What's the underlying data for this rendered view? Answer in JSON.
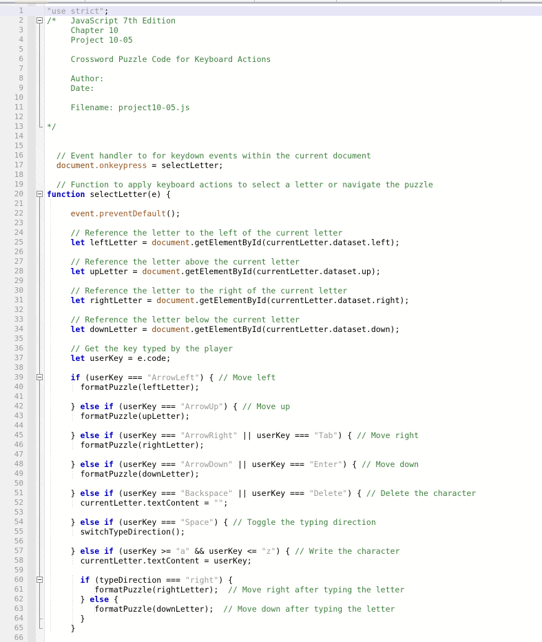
{
  "window": {
    "title": "project10-05.js",
    "language": "JavaScript"
  },
  "toolbar": {
    "visible": true,
    "separator_positions": [
      123,
      369,
      488,
      727
    ],
    "chip": {
      "x": 22,
      "width": 48
    }
  },
  "editor": {
    "first_visible_line": 1,
    "total_visible_lines": 66,
    "current_line": 1,
    "line_height": 14,
    "gutter_width": 64,
    "colors": {
      "background": "#fffffd",
      "line_number_bg": "#f0f0f0",
      "line_number_fg": "#9a9a9a",
      "current_line_bg": "#e6e6f7",
      "keyword": "#0000c0",
      "comment": "#3f7f3f",
      "string": "#9a9a9a",
      "object": "#8a4a12",
      "property": "#9a5a2a",
      "plain": "#000000"
    }
  },
  "fold_markers": [
    {
      "line": 2,
      "type": "open",
      "endline": 13
    },
    {
      "line": 20,
      "type": "open",
      "endline": 65
    },
    {
      "line": 39,
      "type": "open",
      "endline": 65
    },
    {
      "line": 60,
      "type": "open",
      "endline": 64
    }
  ],
  "lines": [
    {
      "n": 1,
      "indent": 0,
      "tokens": [
        {
          "t": "st",
          "v": "\"use strict\""
        },
        {
          "t": "pl",
          "v": ";"
        }
      ]
    },
    {
      "n": 2,
      "indent": 0,
      "tokens": [
        {
          "t": "cm",
          "v": "/*   JavaScript 7th Edition"
        }
      ]
    },
    {
      "n": 3,
      "indent": 0,
      "tokens": [
        {
          "t": "cm",
          "v": "     Chapter 10"
        }
      ]
    },
    {
      "n": 4,
      "indent": 0,
      "tokens": [
        {
          "t": "cm",
          "v": "     Project 10-05"
        }
      ]
    },
    {
      "n": 5,
      "indent": 0,
      "tokens": []
    },
    {
      "n": 6,
      "indent": 0,
      "tokens": [
        {
          "t": "cm",
          "v": "     Crossword Puzzle Code for Keyboard Actions"
        }
      ]
    },
    {
      "n": 7,
      "indent": 0,
      "tokens": []
    },
    {
      "n": 8,
      "indent": 0,
      "tokens": [
        {
          "t": "cm",
          "v": "     Author:"
        }
      ]
    },
    {
      "n": 9,
      "indent": 0,
      "tokens": [
        {
          "t": "cm",
          "v": "     Date:"
        }
      ]
    },
    {
      "n": 10,
      "indent": 0,
      "tokens": []
    },
    {
      "n": 11,
      "indent": 0,
      "tokens": [
        {
          "t": "cm",
          "v": "     Filename: project10-05.js"
        }
      ]
    },
    {
      "n": 12,
      "indent": 0,
      "tokens": []
    },
    {
      "n": 13,
      "indent": 0,
      "tokens": [
        {
          "t": "cm",
          "v": "*/"
        }
      ]
    },
    {
      "n": 14,
      "indent": 0,
      "tokens": []
    },
    {
      "n": 15,
      "indent": 0,
      "tokens": []
    },
    {
      "n": 16,
      "indent": 0,
      "tokens": [
        {
          "t": "cm",
          "v": "  // Event handler to for keydown events within the current document"
        }
      ]
    },
    {
      "n": 17,
      "indent": 0,
      "tokens": [
        {
          "t": "ob",
          "v": "  document"
        },
        {
          "t": "pr",
          "v": ".onkeypress"
        },
        {
          "t": "pl",
          "v": " = selectLetter;"
        }
      ]
    },
    {
      "n": 18,
      "indent": 0,
      "tokens": []
    },
    {
      "n": 19,
      "indent": 0,
      "tokens": [
        {
          "t": "cm",
          "v": "  // Function to apply keyboard actions to select a letter or navigate the puzzle"
        }
      ]
    },
    {
      "n": 20,
      "indent": 0,
      "tokens": [
        {
          "t": "k",
          "v": "function"
        },
        {
          "t": "pl",
          "v": " selectLetter(e) {"
        }
      ]
    },
    {
      "n": 21,
      "indent": 0,
      "tokens": []
    },
    {
      "n": 22,
      "indent": 0,
      "tokens": [
        {
          "t": "ob",
          "v": "     event"
        },
        {
          "t": "pr",
          "v": ".preventDefault"
        },
        {
          "t": "pl",
          "v": "();"
        }
      ]
    },
    {
      "n": 23,
      "indent": 0,
      "tokens": []
    },
    {
      "n": 24,
      "indent": 0,
      "tokens": [
        {
          "t": "cm",
          "v": "     // Reference the letter to the left of the current letter"
        }
      ]
    },
    {
      "n": 25,
      "indent": 0,
      "tokens": [
        {
          "t": "pl",
          "v": "     "
        },
        {
          "t": "k",
          "v": "let"
        },
        {
          "t": "pl",
          "v": " leftLetter = "
        },
        {
          "t": "ob",
          "v": "document"
        },
        {
          "t": "pl",
          "v": ".getElementById(currentLetter.dataset.left);"
        }
      ]
    },
    {
      "n": 26,
      "indent": 0,
      "tokens": []
    },
    {
      "n": 27,
      "indent": 0,
      "tokens": [
        {
          "t": "cm",
          "v": "     // Reference the letter above the current letter"
        }
      ]
    },
    {
      "n": 28,
      "indent": 0,
      "tokens": [
        {
          "t": "pl",
          "v": "     "
        },
        {
          "t": "k",
          "v": "let"
        },
        {
          "t": "pl",
          "v": " upLetter = "
        },
        {
          "t": "ob",
          "v": "document"
        },
        {
          "t": "pl",
          "v": ".getElementById(currentLetter.dataset.up);"
        }
      ]
    },
    {
      "n": 29,
      "indent": 0,
      "tokens": []
    },
    {
      "n": 30,
      "indent": 0,
      "tokens": [
        {
          "t": "cm",
          "v": "     // Reference the letter to the right of the current letter"
        }
      ]
    },
    {
      "n": 31,
      "indent": 0,
      "tokens": [
        {
          "t": "pl",
          "v": "     "
        },
        {
          "t": "k",
          "v": "let"
        },
        {
          "t": "pl",
          "v": " rightLetter = "
        },
        {
          "t": "ob",
          "v": "document"
        },
        {
          "t": "pl",
          "v": ".getElementById(currentLetter.dataset.right);"
        }
      ]
    },
    {
      "n": 32,
      "indent": 0,
      "tokens": []
    },
    {
      "n": 33,
      "indent": 0,
      "tokens": [
        {
          "t": "cm",
          "v": "     // Reference the letter below the current letter"
        }
      ]
    },
    {
      "n": 34,
      "indent": 0,
      "tokens": [
        {
          "t": "pl",
          "v": "     "
        },
        {
          "t": "k",
          "v": "let"
        },
        {
          "t": "pl",
          "v": " downLetter = "
        },
        {
          "t": "ob",
          "v": "document"
        },
        {
          "t": "pl",
          "v": ".getElementById(currentLetter.dataset.down);"
        }
      ]
    },
    {
      "n": 35,
      "indent": 0,
      "tokens": []
    },
    {
      "n": 36,
      "indent": 0,
      "tokens": [
        {
          "t": "cm",
          "v": "     // Get the key typed by the player"
        }
      ]
    },
    {
      "n": 37,
      "indent": 0,
      "tokens": [
        {
          "t": "pl",
          "v": "     "
        },
        {
          "t": "k",
          "v": "let"
        },
        {
          "t": "pl",
          "v": " userKey = e.code;"
        }
      ]
    },
    {
      "n": 38,
      "indent": 0,
      "tokens": []
    },
    {
      "n": 39,
      "indent": 0,
      "tokens": [
        {
          "t": "pl",
          "v": "     "
        },
        {
          "t": "k",
          "v": "if"
        },
        {
          "t": "pl",
          "v": " (userKey === "
        },
        {
          "t": "st",
          "v": "\"ArrowLeft\""
        },
        {
          "t": "pl",
          "v": ") { "
        },
        {
          "t": "cm",
          "v": "// Move left"
        }
      ]
    },
    {
      "n": 40,
      "indent": 0,
      "tokens": [
        {
          "t": "pl",
          "v": "       formatPuzzle(leftLetter);"
        }
      ]
    },
    {
      "n": 41,
      "indent": 0,
      "tokens": []
    },
    {
      "n": 42,
      "indent": 0,
      "tokens": [
        {
          "t": "pl",
          "v": "     } "
        },
        {
          "t": "k",
          "v": "else if"
        },
        {
          "t": "pl",
          "v": " (userKey === "
        },
        {
          "t": "st",
          "v": "\"ArrowUp\""
        },
        {
          "t": "pl",
          "v": ") { "
        },
        {
          "t": "cm",
          "v": "// Move up"
        }
      ]
    },
    {
      "n": 43,
      "indent": 0,
      "tokens": [
        {
          "t": "pl",
          "v": "       formatPuzzle(upLetter);"
        }
      ]
    },
    {
      "n": 44,
      "indent": 0,
      "tokens": []
    },
    {
      "n": 45,
      "indent": 0,
      "tokens": [
        {
          "t": "pl",
          "v": "     } "
        },
        {
          "t": "k",
          "v": "else if"
        },
        {
          "t": "pl",
          "v": " (userKey === "
        },
        {
          "t": "st",
          "v": "\"ArrowRight\""
        },
        {
          "t": "pl",
          "v": " || userKey === "
        },
        {
          "t": "st",
          "v": "\"Tab\""
        },
        {
          "t": "pl",
          "v": ") { "
        },
        {
          "t": "cm",
          "v": "// Move right"
        }
      ]
    },
    {
      "n": 46,
      "indent": 0,
      "tokens": [
        {
          "t": "pl",
          "v": "       formatPuzzle(rightLetter);"
        }
      ]
    },
    {
      "n": 47,
      "indent": 0,
      "tokens": []
    },
    {
      "n": 48,
      "indent": 0,
      "tokens": [
        {
          "t": "pl",
          "v": "     } "
        },
        {
          "t": "k",
          "v": "else if"
        },
        {
          "t": "pl",
          "v": " (userKey === "
        },
        {
          "t": "st",
          "v": "\"ArrowDown\""
        },
        {
          "t": "pl",
          "v": " || userKey === "
        },
        {
          "t": "st",
          "v": "\"Enter\""
        },
        {
          "t": "pl",
          "v": ") { "
        },
        {
          "t": "cm",
          "v": "// Move down"
        }
      ]
    },
    {
      "n": 49,
      "indent": 0,
      "tokens": [
        {
          "t": "pl",
          "v": "       formatPuzzle(downLetter);"
        }
      ]
    },
    {
      "n": 50,
      "indent": 0,
      "tokens": []
    },
    {
      "n": 51,
      "indent": 0,
      "tokens": [
        {
          "t": "pl",
          "v": "     } "
        },
        {
          "t": "k",
          "v": "else if"
        },
        {
          "t": "pl",
          "v": " (userKey === "
        },
        {
          "t": "st",
          "v": "\"Backspace\""
        },
        {
          "t": "pl",
          "v": " || userKey === "
        },
        {
          "t": "st",
          "v": "\"Delete\""
        },
        {
          "t": "pl",
          "v": ") { "
        },
        {
          "t": "cm",
          "v": "// Delete the character"
        }
      ]
    },
    {
      "n": 52,
      "indent": 0,
      "tokens": [
        {
          "t": "pl",
          "v": "       currentLetter.textContent = "
        },
        {
          "t": "st",
          "v": "\"\""
        },
        {
          "t": "pl",
          "v": ";"
        }
      ]
    },
    {
      "n": 53,
      "indent": 0,
      "tokens": []
    },
    {
      "n": 54,
      "indent": 0,
      "tokens": [
        {
          "t": "pl",
          "v": "     } "
        },
        {
          "t": "k",
          "v": "else if"
        },
        {
          "t": "pl",
          "v": " (userKey === "
        },
        {
          "t": "st",
          "v": "\"Space\""
        },
        {
          "t": "pl",
          "v": ") { "
        },
        {
          "t": "cm",
          "v": "// Toggle the typing direction"
        }
      ]
    },
    {
      "n": 55,
      "indent": 0,
      "tokens": [
        {
          "t": "pl",
          "v": "       switchTypeDirection();"
        }
      ]
    },
    {
      "n": 56,
      "indent": 0,
      "tokens": []
    },
    {
      "n": 57,
      "indent": 0,
      "tokens": [
        {
          "t": "pl",
          "v": "     } "
        },
        {
          "t": "k",
          "v": "else if"
        },
        {
          "t": "pl",
          "v": " (userKey >= "
        },
        {
          "t": "st",
          "v": "\"a\""
        },
        {
          "t": "pl",
          "v": " && userKey <= "
        },
        {
          "t": "st",
          "v": "\"z\""
        },
        {
          "t": "pl",
          "v": ") { "
        },
        {
          "t": "cm",
          "v": "// Write the character"
        }
      ]
    },
    {
      "n": 58,
      "indent": 0,
      "tokens": [
        {
          "t": "pl",
          "v": "       currentLetter.textContent = userKey;"
        }
      ]
    },
    {
      "n": 59,
      "indent": 0,
      "tokens": []
    },
    {
      "n": 60,
      "indent": 0,
      "tokens": [
        {
          "t": "pl",
          "v": "       "
        },
        {
          "t": "k",
          "v": "if"
        },
        {
          "t": "pl",
          "v": " (typeDirection === "
        },
        {
          "t": "st",
          "v": "\"right\""
        },
        {
          "t": "pl",
          "v": ") {"
        }
      ]
    },
    {
      "n": 61,
      "indent": 0,
      "tokens": [
        {
          "t": "pl",
          "v": "          formatPuzzle(rightLetter);  "
        },
        {
          "t": "cm",
          "v": "// Move right after typing the letter"
        }
      ]
    },
    {
      "n": 62,
      "indent": 0,
      "tokens": [
        {
          "t": "pl",
          "v": "       } "
        },
        {
          "t": "k",
          "v": "else"
        },
        {
          "t": "pl",
          "v": " {"
        }
      ]
    },
    {
      "n": 63,
      "indent": 0,
      "tokens": [
        {
          "t": "pl",
          "v": "          formatPuzzle(downLetter);  "
        },
        {
          "t": "cm",
          "v": "// Move down after typing the letter"
        }
      ]
    },
    {
      "n": 64,
      "indent": 0,
      "tokens": [
        {
          "t": "pl",
          "v": "       }"
        }
      ]
    },
    {
      "n": 65,
      "indent": 0,
      "tokens": [
        {
          "t": "pl",
          "v": "     }"
        }
      ]
    },
    {
      "n": 66,
      "indent": 0,
      "tokens": []
    }
  ]
}
